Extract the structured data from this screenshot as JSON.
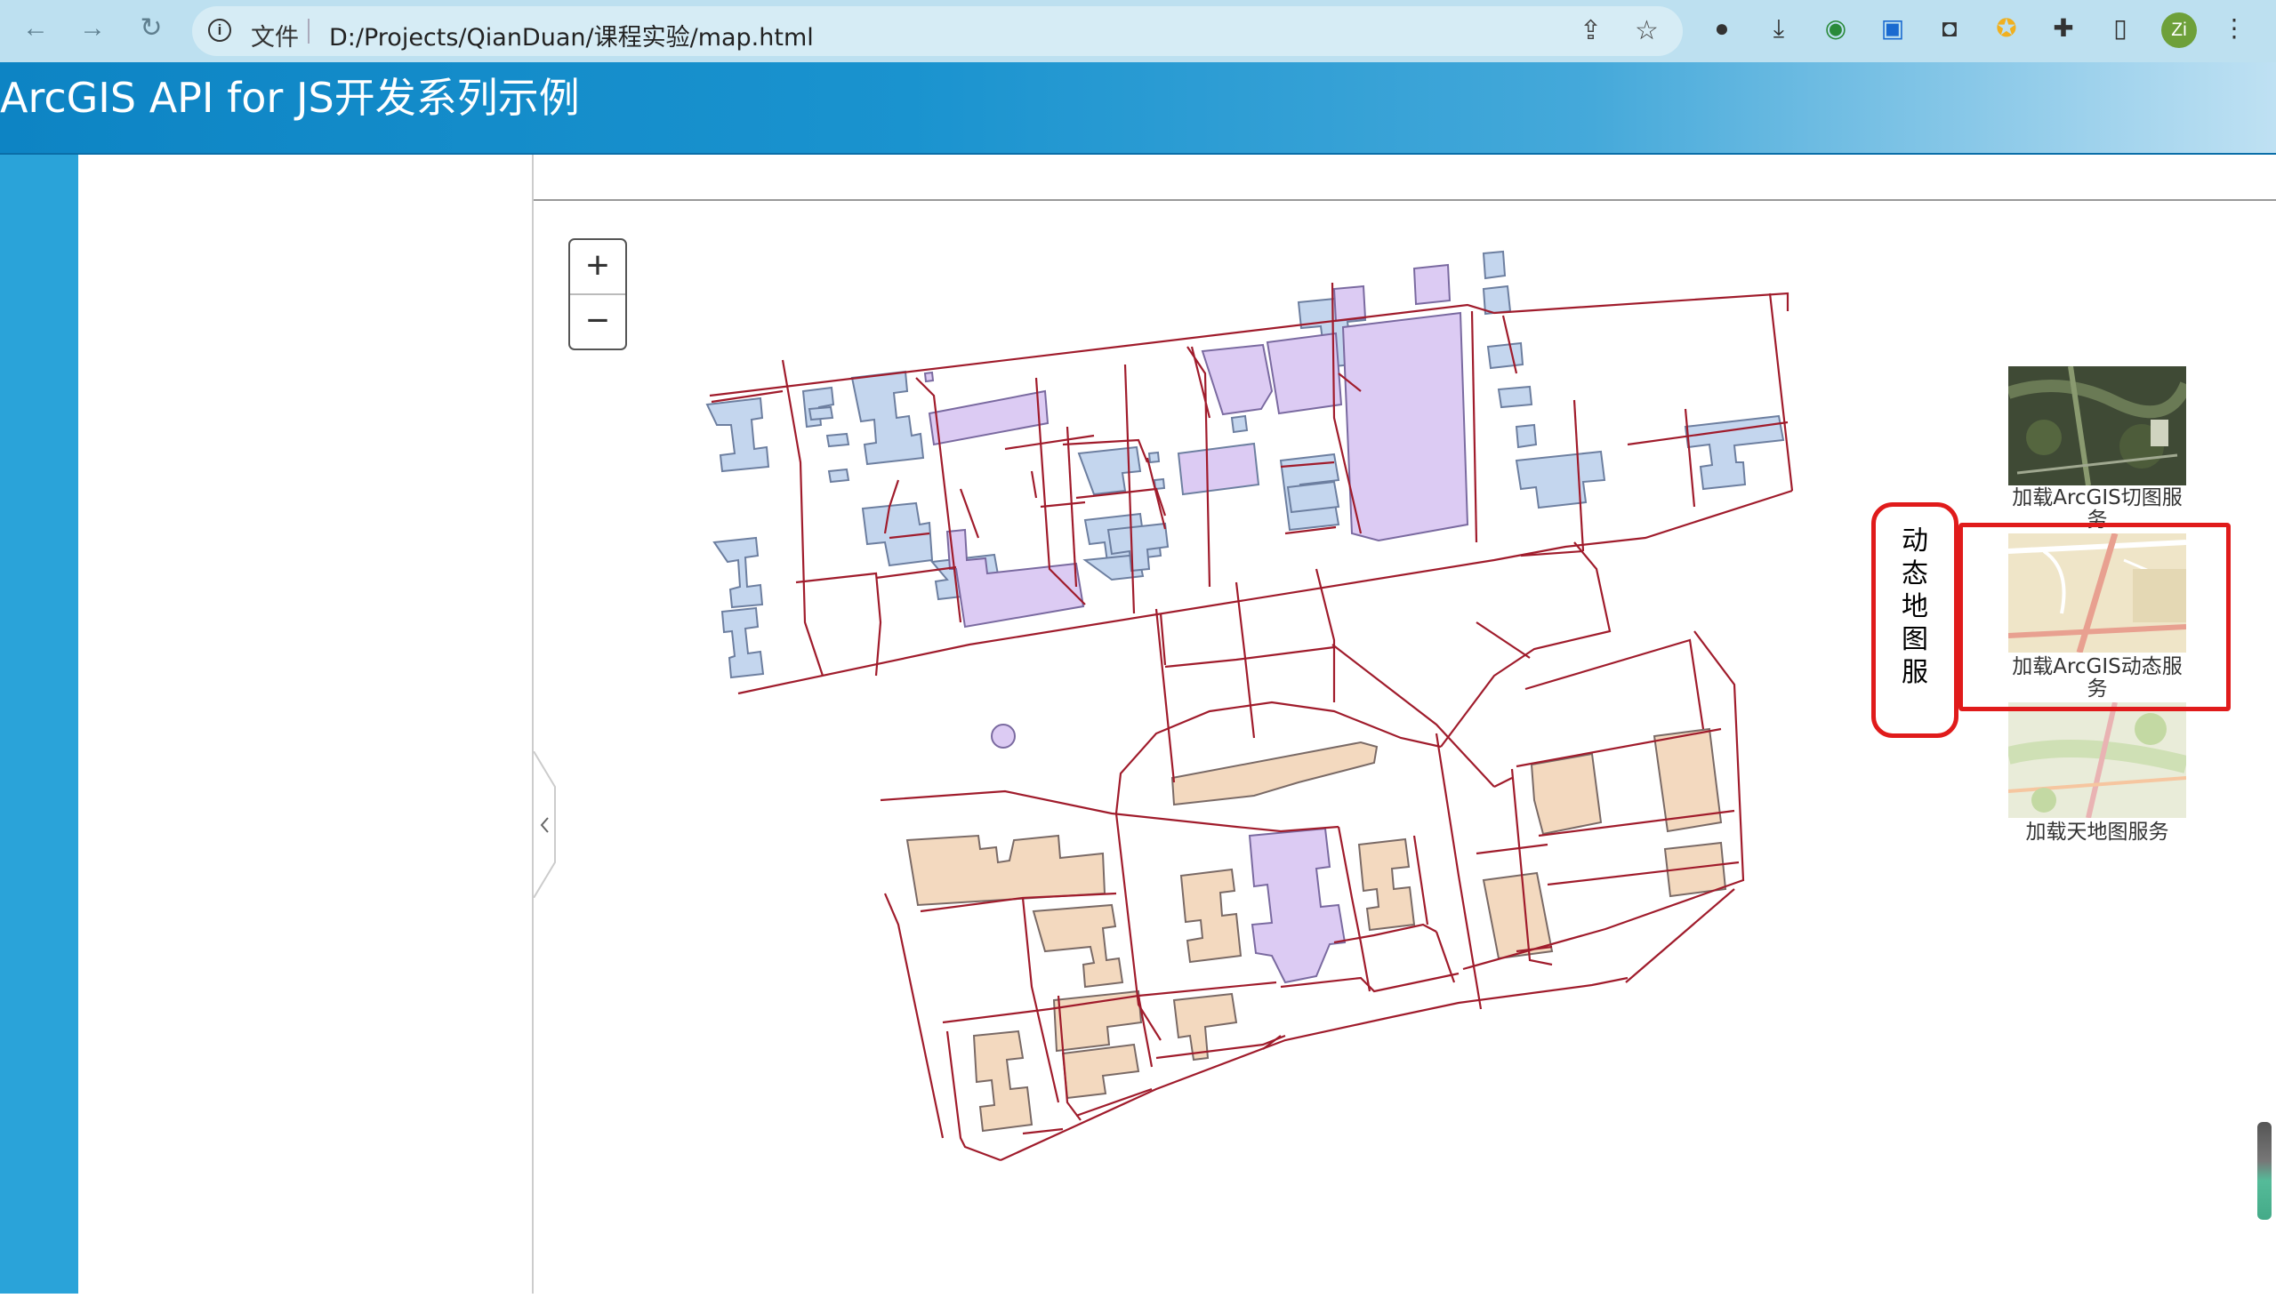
{
  "browser": {
    "back_icon": "arrow-left-icon",
    "forward_icon": "arrow-right-icon",
    "reload_icon": "reload-icon",
    "info_icon": "info-icon",
    "file_label": "文件",
    "url": "D:/Projects/QianDuan/课程实验/map.html",
    "share_icon": "share-icon",
    "star_icon": "star-icon",
    "avatar_label": "Zi",
    "menu_icon": "kebab-menu-icon"
  },
  "page": {
    "title": "ArcGIS API for JS开发系列示例"
  },
  "map": {
    "zoom_in": "+",
    "zoom_out": "−",
    "collapse_icon": "chevron-left-icon",
    "colors": {
      "parcel_line": "#a01c2c",
      "building_blue": "#c4d6ee",
      "building_purple": "#dccbf3",
      "building_tan": "#f3d9bf"
    }
  },
  "basemaps": [
    {
      "label": "加载ArcGIS切图服务"
    },
    {
      "label": "加载ArcGIS动态服务"
    },
    {
      "label": "加载天地图服务"
    }
  ],
  "annotation": {
    "text": "动态地图服"
  }
}
